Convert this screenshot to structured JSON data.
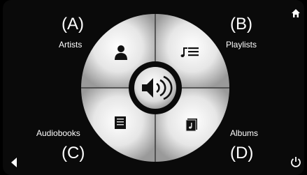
{
  "callouts": {
    "a": "(A)",
    "b": "(B)",
    "c": "(C)",
    "d": "(D)"
  },
  "menu": {
    "artists": "Artists",
    "playlists": "Playlists",
    "audiobooks": "Audiobooks",
    "albums": "Albums"
  },
  "icons": {
    "artists": "person-icon",
    "playlists": "playlist-icon",
    "audiobooks": "book-icon",
    "albums": "album-icon",
    "center": "speaker-icon",
    "top_right": "home-icon",
    "bottom_left": "back-arrow-icon",
    "bottom_right": "power-icon"
  },
  "colors": {
    "background": "#0a0a0a",
    "disc_light": "#f2f2f2",
    "disc_dark": "#9a9a9a",
    "icon_dark": "#111111"
  }
}
